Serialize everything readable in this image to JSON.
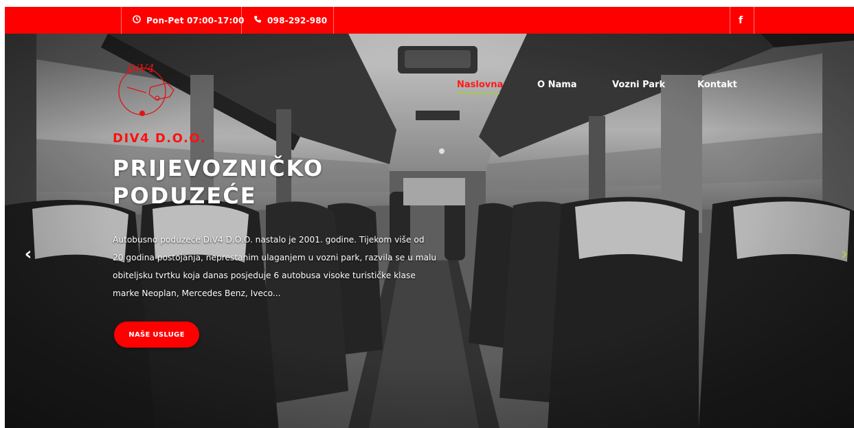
{
  "topbar": {
    "hours": "Pon-Pet 07:00-17:00",
    "phone": "098-292-980",
    "social": "f"
  },
  "logo": {
    "text": "DiV4"
  },
  "nav": {
    "items": [
      {
        "label": "Naslovna"
      },
      {
        "label": "O Nama"
      },
      {
        "label": "Vozni Park"
      },
      {
        "label": "Kontakt"
      }
    ]
  },
  "hero": {
    "eyebrow": "DIV4 D.O.O.",
    "title_line1": "PRIJEVOZNIČKO",
    "title_line2": "PODUZEĆE",
    "description": "Autobusno poduzeće DiV4 D.O.O. nastalo je 2001. godine. Tijekom više od 20 godina postojanja, neprestanim ulaganjem u vozni park, razvila se u malu obiteljsku tvrtku koja danas posjeduje 6 autobusa visoke turističke klase marke Neoplan, Mercedes Benz, Iveco...",
    "cta_label": "NAŠE USLUGE",
    "prev_arrow": "‹",
    "next_arrow": "›"
  },
  "colors": {
    "brand": "#ff0000",
    "accent": "#a7c94a"
  },
  "icons": {
    "hours": "clock-icon",
    "phone": "phone-icon",
    "social": "facebook-icon"
  }
}
